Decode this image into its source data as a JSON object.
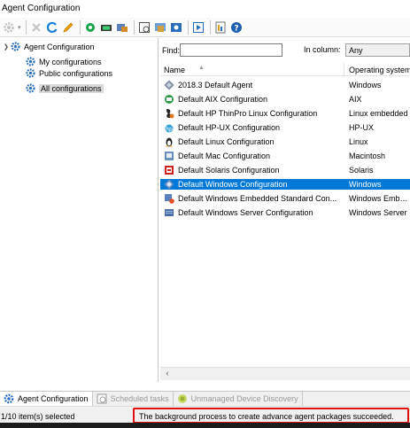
{
  "window": {
    "title": "Agent Configuration"
  },
  "toolbar": {
    "buttons": [
      {
        "icon": "gear-icon",
        "enabled": false
      },
      {
        "icon": "delete-icon",
        "enabled": false
      },
      {
        "icon": "refresh-icon",
        "enabled": true
      },
      {
        "icon": "edit-pencil-icon",
        "enabled": true
      },
      {
        "icon": "settings-icon",
        "enabled": true
      },
      {
        "icon": "agent-package-icon",
        "enabled": true
      },
      {
        "icon": "deploy-icon",
        "enabled": true
      },
      {
        "icon": "schedule-icon",
        "enabled": true
      },
      {
        "icon": "scheduled-task-icon",
        "enabled": true
      },
      {
        "icon": "properties-icon",
        "enabled": true
      },
      {
        "icon": "run-icon",
        "enabled": true
      },
      {
        "icon": "report-icon",
        "enabled": true
      },
      {
        "icon": "help-icon",
        "enabled": true
      }
    ]
  },
  "tree": {
    "root": "Agent Configuration",
    "items": [
      "My configurations",
      "Public configurations",
      "All configurations"
    ],
    "selected": "All configurations"
  },
  "find": {
    "label": "Find:",
    "value": "",
    "column_label": "In column:",
    "column_value": "Any"
  },
  "columns": {
    "name": "Name",
    "os": "Operating system"
  },
  "rows": [
    {
      "name": "2018.3 Default Agent",
      "os": "Windows",
      "icon": "agent-diamond-icon",
      "selected": false
    },
    {
      "name": "Default AIX Configuration",
      "os": "AIX",
      "icon": "aix-icon",
      "selected": false
    },
    {
      "name": "Default HP ThinPro Linux Configuration",
      "os": "Linux embedded",
      "icon": "thinpro-icon",
      "selected": false
    },
    {
      "name": "Default HP-UX Configuration",
      "os": "HP-UX",
      "icon": "hpux-icon",
      "selected": false
    },
    {
      "name": "Default Linux Configuration",
      "os": "Linux",
      "icon": "linux-icon",
      "selected": false
    },
    {
      "name": "Default Mac Configuration",
      "os": "Macintosh",
      "icon": "mac-icon",
      "selected": false
    },
    {
      "name": "Default Solaris Configuration",
      "os": "Solaris",
      "icon": "solaris-icon",
      "selected": false
    },
    {
      "name": "Default Windows Configuration",
      "os": "Windows",
      "icon": "windows-icon",
      "selected": true
    },
    {
      "name": "Default Windows Embedded Standard Con...",
      "os": "Windows Embe...",
      "icon": "windows-embedded-icon",
      "selected": false
    },
    {
      "name": "Default Windows Server Configuration",
      "os": "Windows Server",
      "icon": "windows-server-icon",
      "selected": false
    }
  ],
  "tabs": [
    {
      "label": "Agent Configuration",
      "icon": "gear-icon",
      "active": true
    },
    {
      "label": "Scheduled tasks",
      "icon": "clock-icon",
      "active": false
    },
    {
      "label": "Unmanaged Device Discovery",
      "icon": "discovery-icon",
      "active": false
    }
  ],
  "status": {
    "selection": "1/10 item(s) selected",
    "message": "The background process to create advance agent packages succeeded."
  },
  "colors": {
    "selection": "#0078d7",
    "highlight_border": "#e01010",
    "gear": "#2a6ebb"
  }
}
